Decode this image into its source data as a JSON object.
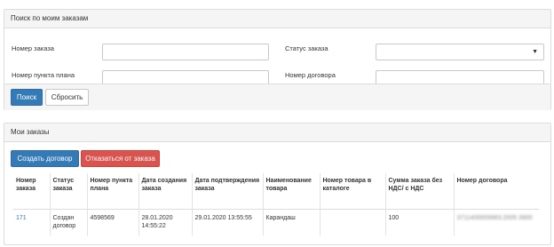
{
  "search": {
    "title": "Поиск по моим заказам",
    "order_number_label": "Номер заказа",
    "order_status_label": "Статус заказа",
    "plan_item_label": "Номер пункта плана",
    "contract_number_label": "Номер договора",
    "order_number_value": "",
    "plan_item_value": "",
    "contract_number_value": "",
    "status_value": "",
    "search_button": "Поиск",
    "reset_button": "Сбросить"
  },
  "orders": {
    "title": "Мои заказы",
    "create_contract_button": "Создать договор",
    "reject_order_button": "Отказаться от заказа",
    "columns": [
      "Номер заказа",
      "Статус заказа",
      "Номер пункта плана",
      "Дата создания заказа",
      "Дата подтверждения заказа",
      "Наименование товара",
      "Номер товара в каталоге",
      "Сумма заказа без НДС/ с НДС",
      "Номер договора"
    ],
    "rows": [
      {
        "order_number": "171",
        "status": "Создан договор",
        "plan_item": "4598569",
        "created": "28.01.2020 14:55:22",
        "confirmed": "29.01.2020 13:55:55",
        "product_name": "Карандаш",
        "catalog_number": "",
        "sum": "100",
        "contract_number": "3711400005683.2005 3900"
      }
    ]
  }
}
